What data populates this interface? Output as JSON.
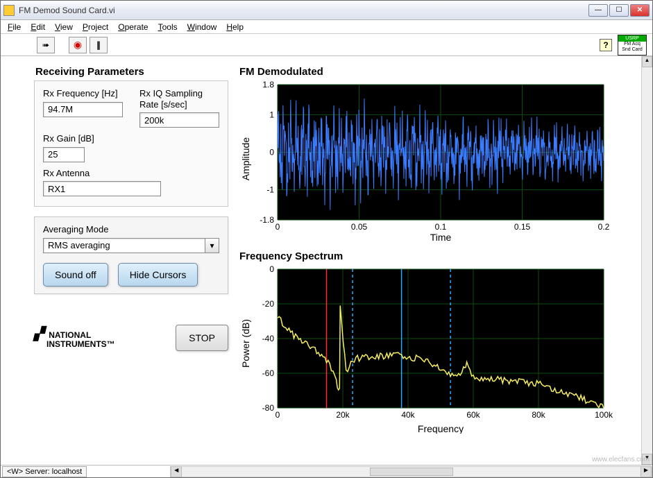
{
  "window": {
    "title": "FM Demod Sound Card.vi"
  },
  "menu": [
    "File",
    "Edit",
    "View",
    "Project",
    "Operate",
    "Tools",
    "Window",
    "Help"
  ],
  "badge": {
    "top": "USRP",
    "l1": "FM Acq",
    "l2": "Snd Card"
  },
  "params": {
    "heading": "Receiving Parameters",
    "rx_freq_label": "Rx Frequency [Hz]",
    "rx_freq_value": "94.7M",
    "rx_iq_label": "Rx IQ Sampling Rate [s/sec]",
    "rx_iq_value": "200k",
    "rx_gain_label": "Rx Gain [dB]",
    "rx_gain_value": "25",
    "rx_ant_label": "Rx Antenna",
    "rx_ant_value": "RX1"
  },
  "avg": {
    "label": "Averaging Mode",
    "value": "RMS averaging"
  },
  "buttons": {
    "sound_off": "Sound off",
    "hide_cursors": "Hide Cursors",
    "stop": "STOP"
  },
  "logo": {
    "line1": "NATIONAL",
    "line2": "INSTRUMENTS",
    "tm": "™"
  },
  "charts": {
    "demod": {
      "title": "FM Demodulated",
      "xlabel": "Time",
      "ylabel": "Amplitude",
      "xticks": [
        "0",
        "0.05",
        "0.1",
        "0.15",
        "0.2"
      ],
      "yticks": [
        "-1.8",
        "-1",
        "0",
        "1",
        "1.8"
      ]
    },
    "spectrum": {
      "title": "Frequency Spectrum",
      "xlabel": "Frequency",
      "ylabel": "Power (dB)",
      "xticks": [
        "0",
        "20k",
        "40k",
        "60k",
        "80k",
        "100k"
      ],
      "yticks": [
        "-80",
        "-60",
        "-40",
        "-20",
        "0"
      ]
    }
  },
  "status": {
    "server": "<W> Server: localhost"
  },
  "watermark": "www.elecfans.com",
  "chart_data": [
    {
      "type": "line",
      "title": "FM Demodulated",
      "xlabel": "Time",
      "ylabel": "Amplitude",
      "xlim": [
        0,
        0.2
      ],
      "ylim": [
        -1.8,
        1.8
      ],
      "note": "Dense noisy FM-demodulated waveform; envelope roughly ±1.3 decaying toward ±0.8 near t=0.2; ~2000 samples shown.",
      "series": [
        {
          "name": "amplitude",
          "color": "#3a7cff"
        }
      ]
    },
    {
      "type": "line",
      "title": "Frequency Spectrum",
      "xlabel": "Frequency",
      "ylabel": "Power (dB)",
      "xlim": [
        0,
        100000
      ],
      "ylim": [
        -80,
        0
      ],
      "cursors": [
        {
          "x": 15000,
          "color": "#ff2d2d",
          "style": "solid"
        },
        {
          "x": 23000,
          "color": "#2da9ff",
          "style": "dash"
        },
        {
          "x": 38000,
          "color": "#2da9ff",
          "style": "solid"
        },
        {
          "x": 53000,
          "color": "#2da9ff",
          "style": "dash"
        }
      ],
      "series": [
        {
          "name": "power",
          "color": "#f7ee62",
          "x": [
            0,
            2000,
            5000,
            10000,
            15000,
            18000,
            19000,
            19200,
            21000,
            23000,
            30000,
            38000,
            45000,
            53000,
            55000,
            57000,
            58000,
            60000,
            70000,
            80000,
            90000,
            100000
          ],
          "values": [
            -28,
            -32,
            -38,
            -45,
            -52,
            -65,
            -70,
            -20,
            -60,
            -52,
            -50,
            -50,
            -52,
            -60,
            -63,
            -58,
            -55,
            -63,
            -64,
            -66,
            -72,
            -80
          ]
        }
      ]
    }
  ]
}
